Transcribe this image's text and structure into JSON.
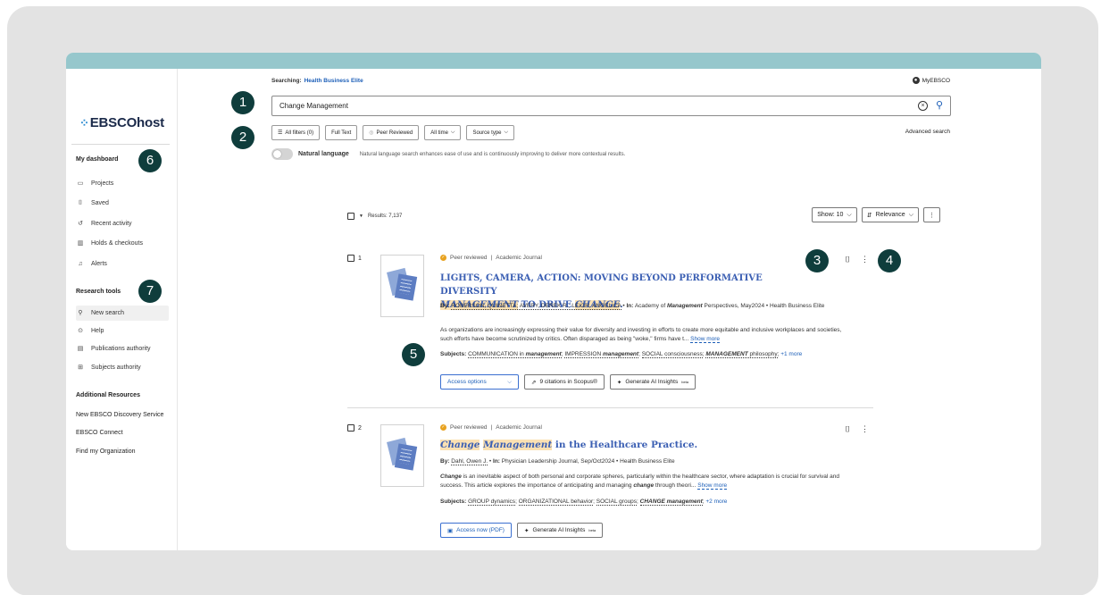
{
  "search": {
    "searching_label": "Searching:",
    "database": "Health Business Elite",
    "query": "Change Management",
    "my_ebsco": "MyEBSCO",
    "advanced_search": "Advanced search"
  },
  "filters": {
    "all_filters": "All filters (0)",
    "full_text": "Full Text",
    "peer_reviewed": "Peer Reviewed",
    "all_time": "All time",
    "source_type": "Source type"
  },
  "natural_language": {
    "label": "Natural language",
    "description": "Natural language search enhances ease of use and is continuously improving to deliver more contextual results."
  },
  "sidebar": {
    "logo": "EBSCOhost",
    "dashboard_heading": "My dashboard",
    "dashboard_items": [
      {
        "label": "Projects",
        "icon": "folder-icon"
      },
      {
        "label": "Saved",
        "icon": "bookmark-icon"
      },
      {
        "label": "Recent activity",
        "icon": "history-icon"
      },
      {
        "label": "Holds & checkouts",
        "icon": "books-icon"
      },
      {
        "label": "Alerts",
        "icon": "bell-icon"
      }
    ],
    "tools_heading": "Research tools",
    "tools_items": [
      {
        "label": "New search",
        "icon": "search-icon"
      },
      {
        "label": "Help",
        "icon": "help-icon"
      },
      {
        "label": "Publications authority",
        "icon": "publication-icon"
      },
      {
        "label": "Subjects authority",
        "icon": "hierarchy-icon"
      }
    ],
    "resources_heading": "Additional Resources",
    "resources_links": [
      "New EBSCO Discovery Service",
      "EBSCO Connect",
      "Find my Organization"
    ]
  },
  "results": {
    "count_label": "Results: 7,137",
    "show": "Show: 10",
    "sort": "Relevance",
    "items": [
      {
        "number": "1",
        "peer": "Peer reviewed",
        "type": "Academic Journal",
        "title_pre": "LIGHTS, CAMERA, ACTION: MOVING BEYOND PERFORMATIVE DIVERSITY",
        "title_hl1": "MANAGEMENT",
        "title_mid": " TO DRIVE ",
        "title_hl2": "CHANGE",
        "title_end": ".",
        "by_label": "By:",
        "authors": "ROBERSON, QUINETTA; AVERY, DEREK R.; LEIGH, ANGELICA",
        "in_label": "In:",
        "source_pre": "Academy of ",
        "source_em": "Management",
        "source_post": " Perspectives, May2024 • Health Business Elite",
        "abstract": "As organizations are increasingly expressing their value for diversity and investing in efforts to create more equitable and inclusive workplaces and societies, such efforts have become scrutinized by critics. Often disparaged as being \"woke,\" firms have t...",
        "show_more": "Show more",
        "subjects_label": "Subjects:",
        "subj1_pre": "COMMUNICATION in ",
        "subj1_em": "management",
        "subj2_pre": "IMPRESSION ",
        "subj2_em": "management",
        "subj3": "SOCIAL consciousness",
        "subj4_em": "MANAGEMENT",
        "subj4_post": " philosophy",
        "more": "+1 more",
        "access": "Access options",
        "citations": "9 citations in Scopus®",
        "ai": "Generate AI Insights",
        "beta": "beta"
      },
      {
        "number": "2",
        "peer": "Peer reviewed",
        "type": "Academic Journal",
        "title_hl1": "Change",
        "title_hl2": "Management",
        "title_end": " in the Healthcare Practice.",
        "by_label": "By:",
        "authors": "Dahl, Owen J.",
        "in_label": "In:",
        "source": "Physician Leadership Journal, Sep/Oct2024 • Health Business Elite",
        "abstract_em": "Change",
        "abstract_a": " is an inevitable aspect of both personal and corporate spheres, particularly within the healthcare sector, where adaptation is crucial for survival and success. This article explores the importance of anticipating and managing ",
        "abstract_em2": "change",
        "abstract_b": " through theori...",
        "show_more": "Show more",
        "subjects_label": "Subjects:",
        "subj1": "GROUP dynamics",
        "subj2": "ORGANIZATIONAL behavior",
        "subj3": "SOCIAL groups",
        "subj4_em": "CHANGE management",
        "more": "+2 more",
        "access": "Access now (PDF)",
        "ai": "Generate AI Insights",
        "beta": "beta"
      }
    ]
  },
  "callouts": [
    "1",
    "2",
    "3",
    "4",
    "5",
    "6",
    "7"
  ],
  "colors": {
    "accent": "#1d5fb8",
    "title": "#3b5fb3",
    "highlight": "#fbe1b3",
    "callout": "#0f3d3c",
    "topbar": "#96c7cc"
  }
}
